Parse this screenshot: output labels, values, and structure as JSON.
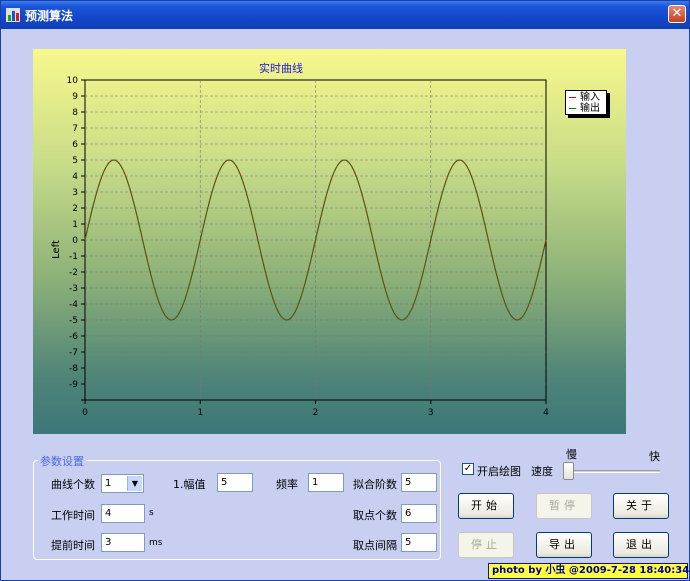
{
  "window": {
    "title": "预测算法",
    "close_label": "✕"
  },
  "chart": {
    "title": "实时曲线",
    "ylabel": "Left"
  },
  "chart_data": {
    "type": "line",
    "title": "实时曲线",
    "xlabel": "",
    "ylabel": "Left",
    "xlim": [
      0,
      4
    ],
    "ylim": [
      10,
      10
    ],
    "x_ticks": [
      "0",
      "1",
      "2",
      "3",
      "4"
    ],
    "y_ticks": [
      "10",
      "9",
      "8",
      "7",
      "6",
      "5",
      "4",
      "3",
      "2",
      "1",
      "0",
      "-1",
      "-2",
      "-3",
      "-4",
      "-5",
      "-6",
      "-7",
      "-8",
      "-9"
    ],
    "grid": true,
    "legend": "top-right",
    "series": [
      {
        "name": "输入",
        "color": "#d01010",
        "function": "5*sin(2*pi*x)",
        "x_range": [
          0,
          4
        ]
      },
      {
        "name": "输出",
        "color": "#108010",
        "function": "5*sin(2*pi*x)",
        "x_range": [
          0,
          4
        ]
      }
    ]
  },
  "params": {
    "group_title": "参数设置",
    "curve_count_label": "曲线个数",
    "curve_count_value": "1",
    "amplitude_label": "1.幅值",
    "amplitude_value": "5",
    "freq_label": "频率",
    "freq_value": "1",
    "fit_order_label": "拟合阶数",
    "fit_order_value": "5",
    "work_time_label": "工作时间",
    "work_time_value": "4",
    "work_time_unit": "s",
    "sample_count_label": "取点个数",
    "sample_count_value": "6",
    "advance_time_label": "提前时间",
    "advance_time_value": "3",
    "advance_time_unit": "ms",
    "sample_interval_label": "取点间隔",
    "sample_interval_value": "5"
  },
  "controls": {
    "enable_plot_label": "开启绘图",
    "enable_plot_checked": true,
    "speed_label": "速度",
    "slow_label": "慢",
    "fast_label": "快",
    "speed_value": 0
  },
  "buttons": {
    "start": "开始",
    "pause": "暂停",
    "about": "关于",
    "stop": "停止",
    "export": "导出",
    "exit": "退出"
  },
  "watermark": "photo by 小虫 @2009-7-28 18:40:34"
}
